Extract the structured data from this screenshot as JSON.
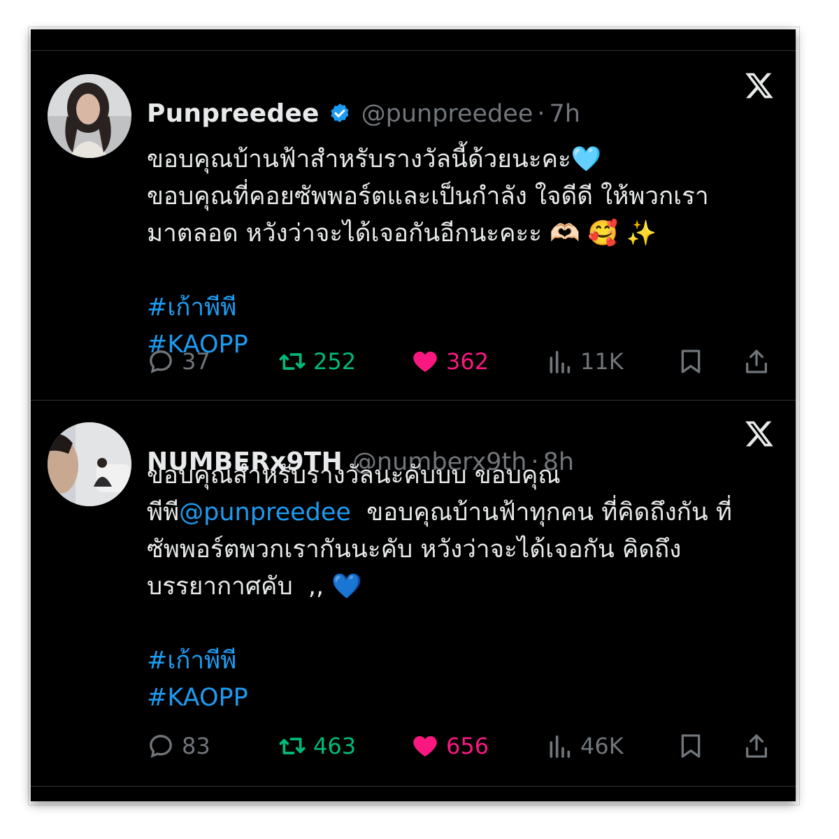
{
  "tweets": [
    {
      "name": "Punpreedee",
      "verified": true,
      "handle": "@punpreedee",
      "dot": "·",
      "time": "7h",
      "lines": [
        "ขอบคุณบ้านฟ้าสำหรับรางวัลนี้ด้วยนะคะ🩵",
        "ขอบคุณที่คอยซัพพอร์ตและเป็นกำลัง ใจดีดี ให้พวกเรา",
        "มาตลอด หวังว่าจะได้เจอกันอีกนะคะะ 🫶🏻 🥰 ✨"
      ],
      "hashtags": [
        "#เก้าพีพี",
        "#KAOPP"
      ],
      "replies": "37",
      "retweets": "252",
      "likes": "362",
      "views": "11K"
    },
    {
      "name": "NUMBERx9TH",
      "verified": false,
      "handle": "@numberx9th",
      "dot": "·",
      "time": "8h",
      "line1": "ขอบคุณสำหรับรางวัลนะคับบบ ขอบคุณ",
      "line2_pre": "พีพี",
      "line2_mention": "@punpreedee",
      "line2_post": "  ขอบคุณบ้านฟ้าทุกคน ที่คิดถึงกัน ที่",
      "line3": "ซัพพอร์ตพวกเรากันนะคับ หวังว่าจะได้เจอกัน คิดถึง",
      "line4": "บรรยากาศคับ  ,, 💙",
      "hashtags": [
        "#เก้าพีพี",
        "#KAOPP"
      ],
      "replies": "83",
      "retweets": "463",
      "likes": "656",
      "views": "46K"
    }
  ],
  "colors": {
    "background": "#000000",
    "text": "#e7e9ea",
    "muted": "#71767b",
    "link": "#1d9bf0",
    "retweet": "#00ba7c",
    "like": "#f91880"
  }
}
